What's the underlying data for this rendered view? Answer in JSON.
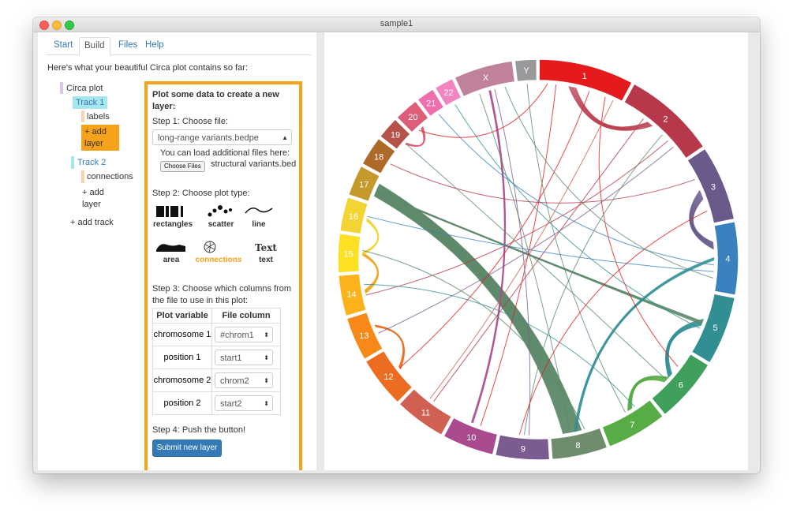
{
  "window": {
    "title": "sample1"
  },
  "tabs": [
    {
      "label": "Start"
    },
    {
      "label": "Build"
    },
    {
      "label": "Files"
    },
    {
      "label": "Help"
    }
  ],
  "intro": "Here's what your beautiful Circa plot contains so far:",
  "tree": {
    "root": "Circa plot",
    "track1": "Track 1",
    "labels": "labels",
    "add_layer_active_1": "+ add",
    "add_layer_active_2": "layer",
    "track2": "Track 2",
    "connections": "connections",
    "add_layer_1": "+ add",
    "add_layer_2": "layer",
    "add_track": "+ add track"
  },
  "panel": {
    "heading_1": "Plot some data to create a new",
    "heading_2": "layer:",
    "step1": "Step 1: Choose file:",
    "file_selected": "long-range variants.bedpe",
    "load_hint": "You can load additional files here:",
    "choose_files": "Choose Files",
    "chosen_file": "structural variants.bed",
    "step2": "Step 2: Choose plot type:",
    "plot_types": [
      "rectangles",
      "scatter",
      "line",
      "area",
      "connections",
      "text"
    ],
    "text_icon": "Text",
    "step3_1": "Step 3: Choose which columns from",
    "step3_2": "the file to use in this plot:",
    "col_header_var": "Plot variable",
    "col_header_file": "File column",
    "rows": [
      {
        "variable": "chromosome 1",
        "column": "#chrom1"
      },
      {
        "variable": "position 1",
        "column": "start1"
      },
      {
        "variable": "chromosome 2",
        "column": "chrom2"
      },
      {
        "variable": "position 2",
        "column": "start2"
      }
    ],
    "step4": "Step 4: Push the button!",
    "submit": "Submit new layer"
  },
  "chart_data": {
    "type": "chord",
    "chromosomes": [
      {
        "name": "1",
        "length": 249,
        "color": "#e41a1c"
      },
      {
        "name": "2",
        "length": 243,
        "color": "#b7384a"
      },
      {
        "name": "3",
        "length": 198,
        "color": "#6a5a8c"
      },
      {
        "name": "4",
        "length": 191,
        "color": "#3a82bd"
      },
      {
        "name": "5",
        "length": 181,
        "color": "#318f94"
      },
      {
        "name": "6",
        "length": 171,
        "color": "#3fa05c"
      },
      {
        "name": "7",
        "length": 159,
        "color": "#58ac45"
      },
      {
        "name": "8",
        "length": 146,
        "color": "#6f8d6c"
      },
      {
        "name": "9",
        "length": 141,
        "color": "#7b5c91"
      },
      {
        "name": "10",
        "length": 136,
        "color": "#a94b8e"
      },
      {
        "name": "11",
        "length": 135,
        "color": "#cf6052"
      },
      {
        "name": "12",
        "length": 134,
        "color": "#ec6d21"
      },
      {
        "name": "13",
        "length": 115,
        "color": "#f88918"
      },
      {
        "name": "14",
        "length": 107,
        "color": "#fcb31b"
      },
      {
        "name": "15",
        "length": 102,
        "color": "#fbe024"
      },
      {
        "name": "16",
        "length": 90,
        "color": "#f2d433"
      },
      {
        "name": "17",
        "length": 81,
        "color": "#c59a2d"
      },
      {
        "name": "18",
        "length": 78,
        "color": "#ae6a28"
      },
      {
        "name": "19",
        "length": 59,
        "color": "#b5534b"
      },
      {
        "name": "20",
        "length": 64,
        "color": "#de5d79"
      },
      {
        "name": "21",
        "length": 48,
        "color": "#ee6eae"
      },
      {
        "name": "22",
        "length": 51,
        "color": "#f285bf"
      },
      {
        "name": "X",
        "length": 155,
        "color": "#c0819a"
      },
      {
        "name": "Y",
        "length": 57,
        "color": "#999999"
      }
    ],
    "bundles": [
      {
        "c1": "17",
        "p1": 0.5,
        "c2": "8",
        "p2": 0.55,
        "n": 40,
        "color": "#5d8a6a"
      },
      {
        "c1": "14",
        "p1": 0.5,
        "c2": "15",
        "p2": 0.5,
        "n": 9,
        "color": "#f5a623"
      },
      {
        "c1": "16",
        "p1": 0.5,
        "c2": "15",
        "p2": 0.5,
        "n": 8,
        "color": "#f2d433"
      },
      {
        "c1": "20",
        "p1": 0.5,
        "c2": "19",
        "p2": 0.5,
        "n": 10,
        "color": "#de5d79"
      },
      {
        "c1": "3",
        "p1": 0.55,
        "c2": "4",
        "p2": 0.3,
        "n": 12,
        "color": "#6a5a8c"
      },
      {
        "c1": "5",
        "p1": 0.5,
        "c2": "6",
        "p2": 0.5,
        "n": 10,
        "color": "#318f94"
      },
      {
        "c1": "6",
        "p1": 0.6,
        "c2": "7",
        "p2": 0.4,
        "n": 10,
        "color": "#58ac45"
      },
      {
        "c1": "1",
        "p1": 0.4,
        "c2": "2",
        "p2": 0.4,
        "n": 8,
        "color": "#b7384a"
      },
      {
        "c1": "10",
        "p1": 0.6,
        "c2": "X",
        "p2": 0.5,
        "n": 4,
        "color": "#a94b8e"
      },
      {
        "c1": "12",
        "p1": 0.5,
        "c2": "13",
        "p2": 0.6,
        "n": 6,
        "color": "#ec6d21"
      },
      {
        "c1": "17",
        "p1": 0.4,
        "c2": "5",
        "p2": 0.5,
        "n": 6,
        "color": "#5d8a6a"
      },
      {
        "c1": "8",
        "p1": 0.5,
        "c2": "4",
        "p2": 0.5,
        "n": 5,
        "color": "#318f94"
      }
    ],
    "links": [
      {
        "c1": "1",
        "p1": 0.2,
        "c2": "10",
        "p2": 0.4,
        "color": "#e41a1c"
      },
      {
        "c1": "1",
        "p1": 0.6,
        "c2": "12",
        "p2": 0.5,
        "color": "#e41a1c"
      },
      {
        "c1": "1",
        "p1": 0.8,
        "c2": "6",
        "p2": 0.3,
        "color": "#e41a1c"
      },
      {
        "c1": "2",
        "p1": 0.3,
        "c2": "11",
        "p2": 0.5,
        "color": "#b7384a"
      },
      {
        "c1": "2",
        "p1": 0.7,
        "c2": "14",
        "p2": 0.4,
        "color": "#b7384a"
      },
      {
        "c1": "X",
        "p1": 0.3,
        "c2": "8",
        "p2": 0.6,
        "color": "#5d8a6a"
      },
      {
        "c1": "X",
        "p1": 0.6,
        "c2": "9",
        "p2": 0.4,
        "color": "#7b5c91"
      },
      {
        "c1": "Y",
        "p1": 0.5,
        "c2": "7",
        "p2": 0.5,
        "color": "#5d8a6a"
      },
      {
        "c1": "22",
        "p1": 0.5,
        "c2": "5",
        "p2": 0.6,
        "color": "#318f94"
      },
      {
        "c1": "21",
        "p1": 0.5,
        "c2": "4",
        "p2": 0.6,
        "color": "#3a82bd"
      },
      {
        "c1": "19",
        "p1": 0.5,
        "c2": "6",
        "p2": 0.6,
        "color": "#5d8a6a"
      },
      {
        "c1": "18",
        "p1": 0.5,
        "c2": "3",
        "p2": 0.3,
        "color": "#b7384a"
      },
      {
        "c1": "16",
        "p1": 0.6,
        "c2": "4",
        "p2": 0.7,
        "color": "#3a82bd"
      },
      {
        "c1": "13",
        "p1": 0.4,
        "c2": "2",
        "p2": 0.8,
        "color": "#7b5c91"
      },
      {
        "c1": "11",
        "p1": 0.6,
        "c2": "1",
        "p2": 0.9,
        "color": "#cf6052"
      },
      {
        "c1": "9",
        "p1": 0.5,
        "c2": "2",
        "p2": 0.6,
        "color": "#5d8a6a"
      },
      {
        "c1": "15",
        "p1": 0.6,
        "c2": "8",
        "p2": 0.3,
        "color": "#5d8a6a"
      },
      {
        "c1": "14",
        "p1": 0.7,
        "c2": "7",
        "p2": 0.3,
        "color": "#318f94"
      },
      {
        "c1": "3",
        "p1": 0.8,
        "c2": "9",
        "p2": 0.6,
        "color": "#e41a1c"
      },
      {
        "c1": "20",
        "p1": 0.3,
        "c2": "1",
        "p2": 0.1,
        "color": "#e41a1c"
      },
      {
        "c1": "X",
        "p1": 0.8,
        "c2": "4",
        "p2": 0.8,
        "color": "#5d8a6a"
      }
    ]
  }
}
